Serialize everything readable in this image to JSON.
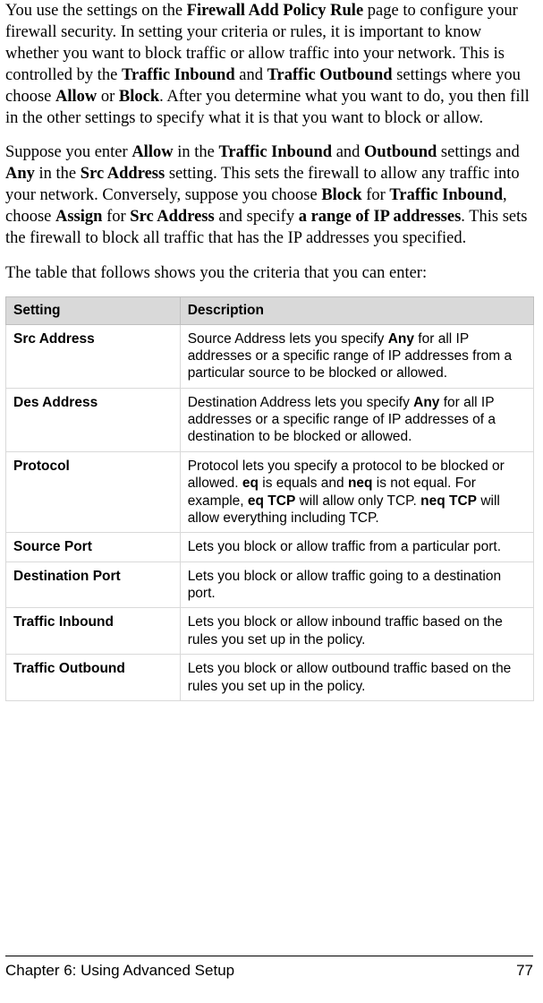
{
  "intro": {
    "p1": {
      "t1": "You use the settings on the ",
      "b1": "Firewall Add Policy Rule",
      "t2": " page to configure your firewall security. In setting your criteria or rules, it is important to know whether you want to block traffic or allow traffic into your network. This is controlled by the ",
      "b2": "Traffic Inbound",
      "t3": " and ",
      "b3": "Traffic Outbound",
      "t4": " settings where you choose ",
      "b4": "Allow",
      "t5": " or ",
      "b5": "Block",
      "t6": ". After you determine what you want to do, you then fill in the other settings to specify what it is that you want to block or allow."
    },
    "p2": {
      "t1": "Suppose you enter ",
      "b1": "Allow",
      "t2": " in the ",
      "b2": "Traffic Inbound",
      "t3": " and ",
      "b3": "Outbound",
      "t4": " settings and ",
      "b4": "Any",
      "t5": " in the ",
      "b5": "Src Address",
      "t6": " setting. This sets the firewall to allow any traffic into your network. Conversely, suppose you choose ",
      "b6": "Block",
      "t7": " for ",
      "b7": "Traffic Inbound",
      "t8": ", choose ",
      "b8": "Assign",
      "t9": " for ",
      "b9": "Src Address",
      "t10": " and specify ",
      "b10": "a range of IP addresses",
      "t11": ". This sets the firewall to block all traffic that has the IP addresses you specified."
    },
    "p3": "The table that follows shows you the criteria that you can enter:"
  },
  "table": {
    "headers": {
      "setting": "Setting",
      "description": "Description"
    },
    "rows": [
      {
        "name": "Src Address",
        "desc": {
          "t1": "Source Address lets you specify ",
          "b1": "Any",
          "t2": " for all IP addresses or a specific range of IP addresses from a particular source to be blocked or allowed."
        }
      },
      {
        "name": "Des Address",
        "desc": {
          "t1": "Destination Address lets you specify ",
          "b1": "Any",
          "t2": " for all IP addresses or a specific range of IP addresses of a destination to be blocked or allowed."
        }
      },
      {
        "name": "Protocol",
        "desc": {
          "t1": "Protocol lets you specify a protocol to be blocked or allowed. ",
          "b1": "eq",
          "t2": " is equals and ",
          "b2": "neq",
          "t3": " is not equal. For example, ",
          "b3": "eq TCP",
          "t4": " will allow only TCP. ",
          "b4": "neq TCP",
          "t5": " will allow everything including TCP."
        }
      },
      {
        "name": "Source Port",
        "desc": {
          "t1": "Lets you block or allow traffic from a particular port."
        }
      },
      {
        "name": "Destination Port",
        "desc": {
          "t1": "Lets you block or allow traffic going to a destination port."
        }
      },
      {
        "name": "Traffic Inbound",
        "desc": {
          "t1": "Lets you block or allow inbound traffic based on the rules you set up in the policy."
        }
      },
      {
        "name": "Traffic Outbound",
        "desc": {
          "t1": "Lets you block or allow outbound traffic based on the rules you set up in the policy."
        }
      }
    ]
  },
  "footer": {
    "chapter": "Chapter 6: Using Advanced Setup",
    "page": "77"
  }
}
